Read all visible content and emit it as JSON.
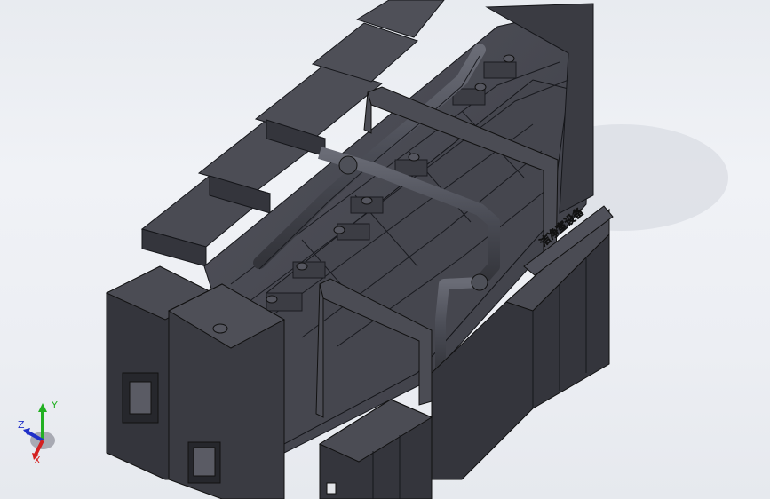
{
  "viewport": {
    "background_top": "#e8ebf0",
    "background_bottom": "#e6e9ee",
    "model_color": "#3f4048",
    "edge_color": "#15161a"
  },
  "model": {
    "panel_text": "洁净室设备"
  },
  "triad": {
    "x_label": "X",
    "y_label": "Y",
    "z_label": "Z",
    "x_color": "#d42020",
    "y_color": "#22b022",
    "z_color": "#2030c8"
  }
}
